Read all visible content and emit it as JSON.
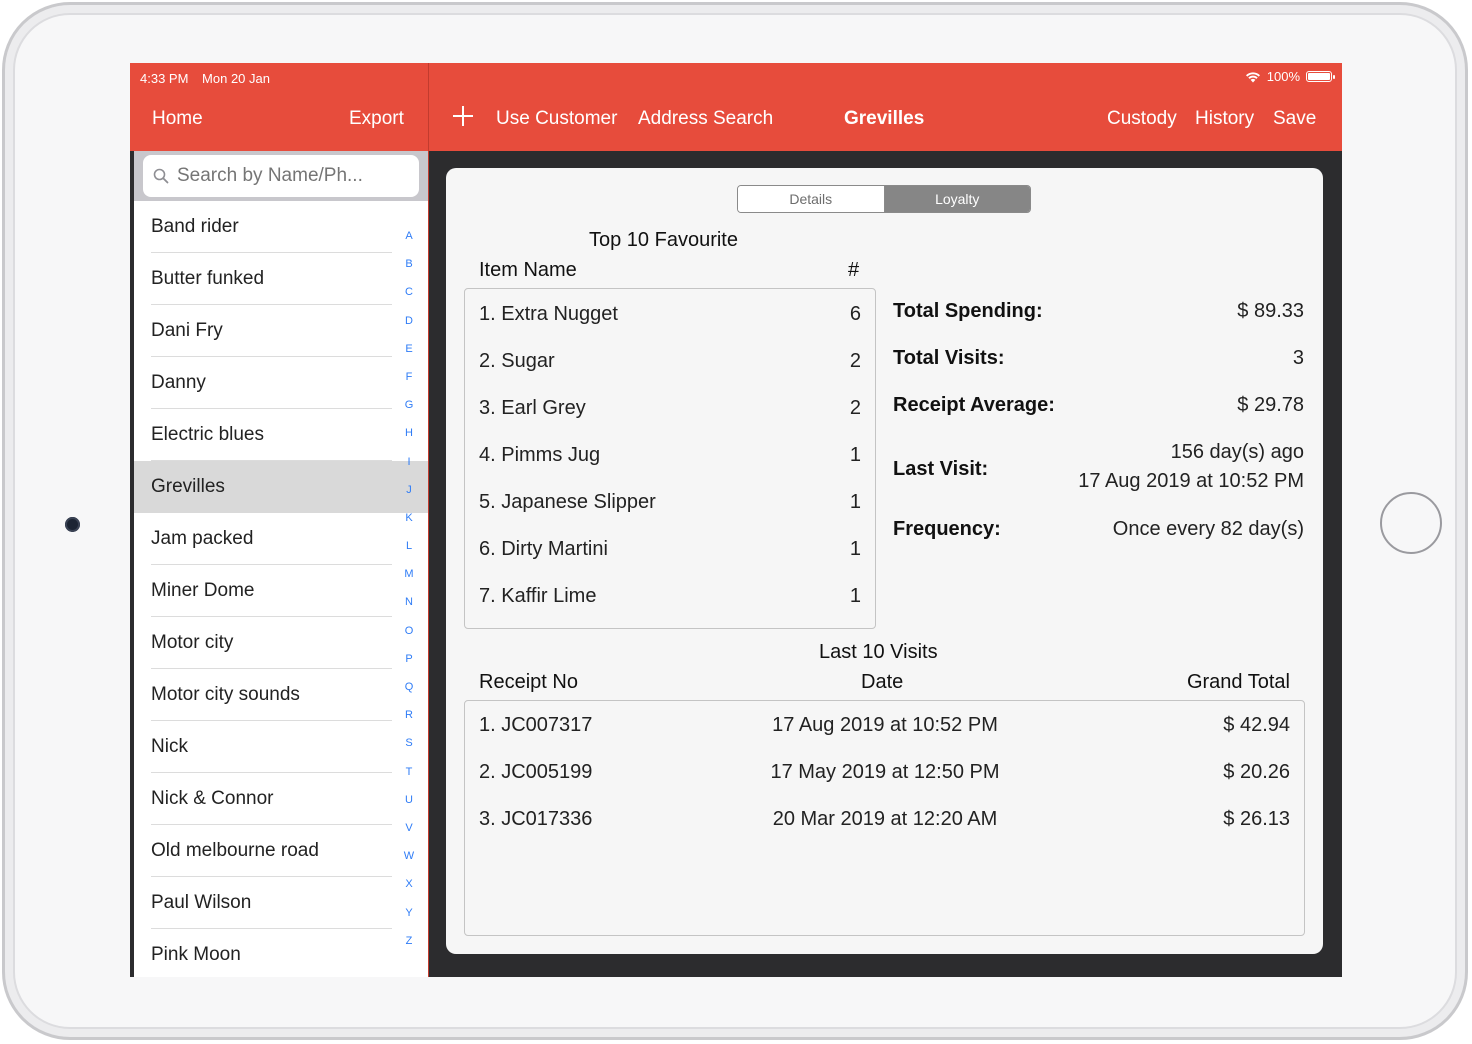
{
  "status_bar": {
    "time": "4:33 PM",
    "date": "Mon 20 Jan",
    "battery": "100%",
    "battery_level": 1.0
  },
  "master_nav": {
    "home_label": "Home",
    "export_label": "Export"
  },
  "detail_nav": {
    "use_customer_label": "Use Customer",
    "address_search_label": "Address Search",
    "title": "Grevilles",
    "custody_label": "Custody",
    "history_label": "History",
    "save_label": "Save"
  },
  "search": {
    "placeholder": "Search by Name/Ph..."
  },
  "customers": [
    {
      "name": "Band rider"
    },
    {
      "name": "Butter funked"
    },
    {
      "name": "Dani Fry"
    },
    {
      "name": "Danny"
    },
    {
      "name": "Electric blues"
    },
    {
      "name": "Grevilles"
    },
    {
      "name": "Jam packed"
    },
    {
      "name": "Miner Dome"
    },
    {
      "name": "Motor city"
    },
    {
      "name": "Motor city sounds"
    },
    {
      "name": "Nick"
    },
    {
      "name": "Nick & Connor"
    },
    {
      "name": "Old melbourne road"
    },
    {
      "name": "Paul Wilson"
    },
    {
      "name": "Pink Moon"
    }
  ],
  "selected_customer": "Grevilles",
  "index_letters": [
    "A",
    "B",
    "C",
    "D",
    "E",
    "F",
    "G",
    "H",
    "I",
    "J",
    "K",
    "L",
    "M",
    "N",
    "O",
    "P",
    "Q",
    "R",
    "S",
    "T",
    "U",
    "V",
    "W",
    "X",
    "Y",
    "Z"
  ],
  "tabs": {
    "details": "Details",
    "loyalty": "Loyalty",
    "active": "Loyalty"
  },
  "favourites": {
    "title": "Top 10 Favourite",
    "col_name": "Item Name",
    "col_count": "#",
    "items": [
      {
        "name": "1. Extra Nugget",
        "count": "6"
      },
      {
        "name": "2. Sugar",
        "count": "2"
      },
      {
        "name": "3. Earl Grey",
        "count": "2"
      },
      {
        "name": "4. Pimms Jug",
        "count": "1"
      },
      {
        "name": "5. Japanese Slipper",
        "count": "1"
      },
      {
        "name": "6. Dirty Martini",
        "count": "1"
      },
      {
        "name": "7. Kaffir Lime",
        "count": "1"
      }
    ]
  },
  "stats": {
    "total_spending_label": "Total Spending:",
    "total_spending_value": "$ 89.33",
    "total_visits_label": "Total Visits:",
    "total_visits_value": "3",
    "receipt_average_label": "Receipt Average:",
    "receipt_average_value": "$ 29.78",
    "last_visit_label": "Last Visit:",
    "last_visit_ago": "156 day(s) ago",
    "last_visit_date": "17 Aug 2019 at 10:52 PM",
    "frequency_label": "Frequency:",
    "frequency_value": "Once every 82 day(s)"
  },
  "visits": {
    "title": "Last 10 Visits",
    "col_receipt": "Receipt No",
    "col_date": "Date",
    "col_total": "Grand Total",
    "rows": [
      {
        "receipt": "1. JC007317",
        "date": "17 Aug 2019 at 10:52 PM",
        "total": "$ 42.94"
      },
      {
        "receipt": "2. JC005199",
        "date": "17 May 2019 at 12:50 PM",
        "total": "$ 20.26"
      },
      {
        "receipt": "3. JC017336",
        "date": "20 Mar 2019 at 12:20 AM",
        "total": "$ 26.13"
      }
    ]
  },
  "colors": {
    "accent": "#e74c3c",
    "index_blue": "#2f7cf6",
    "selected_row": "#d9d9d9"
  }
}
